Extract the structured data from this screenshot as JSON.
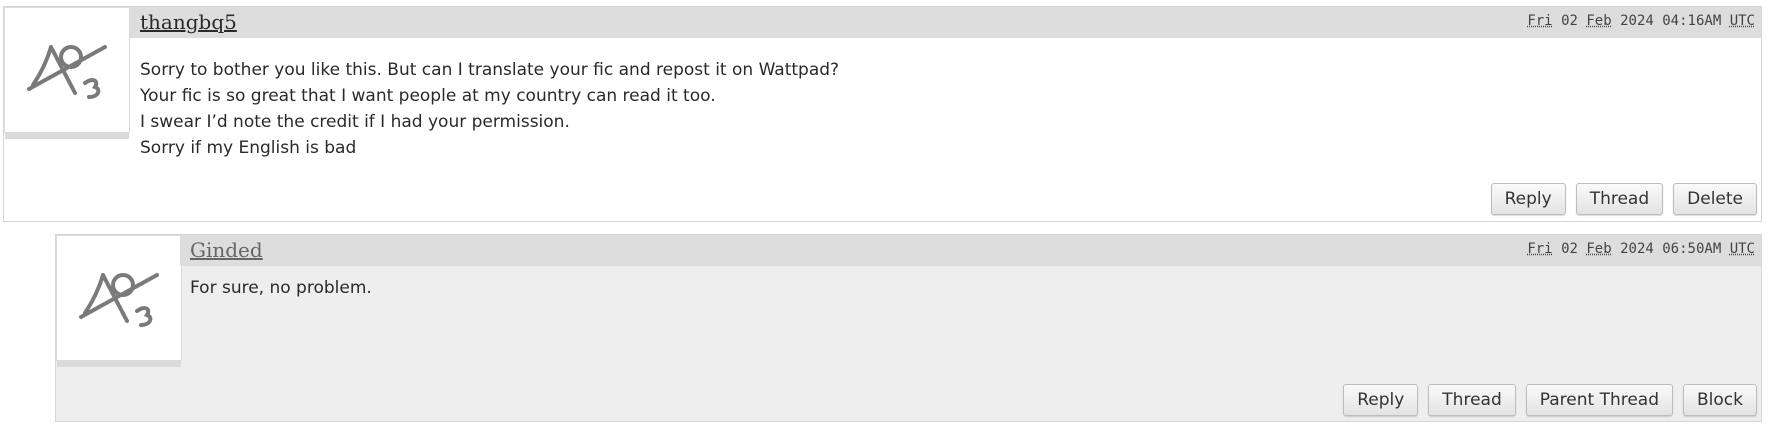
{
  "comments": [
    {
      "byline": "thangbq5",
      "datetime": {
        "day": "Fri",
        "date": "02",
        "month": "Feb",
        "year": "2024",
        "time": "04:16AM",
        "zone": "UTC"
      },
      "lines": [
        "Sorry to bother you like this. But can I translate your fic and repost it on Wattpad?",
        "Your fic is so great that I want people at my country can read it too.",
        "I swear I’d note the credit if I had your permission.",
        "Sorry if my English is bad"
      ],
      "actions": [
        "Reply",
        "Thread",
        "Delete"
      ]
    },
    {
      "byline": "Ginded",
      "datetime": {
        "day": "Fri",
        "date": "02",
        "month": "Feb",
        "year": "2024",
        "time": "06:50AM",
        "zone": "UTC"
      },
      "lines": [
        "For sure, no problem."
      ],
      "actions": [
        "Reply",
        "Thread",
        "Parent Thread",
        "Block"
      ]
    }
  ],
  "icons": {
    "avatar": "default-avatar-icon"
  },
  "colors": {
    "header_bg": "#dddddd",
    "reply_bg": "#eeeeee",
    "text": "#2a2a2a"
  }
}
